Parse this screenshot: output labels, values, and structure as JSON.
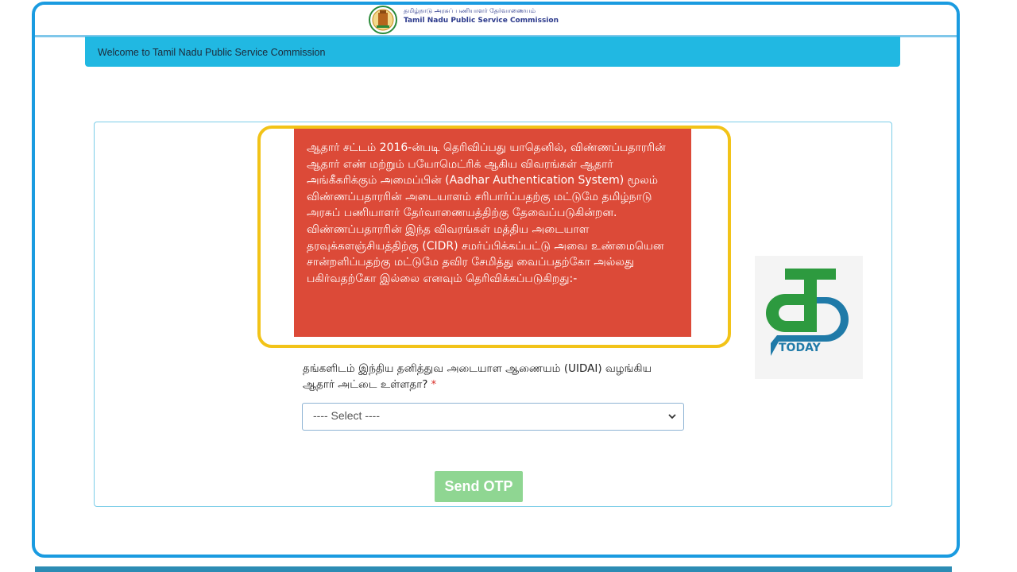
{
  "header": {
    "org_name_tamil": "தமிழ்நாடு அரசுப் பணியாளர் தேர்வாணையம்",
    "org_name_english": "Tamil Nadu Public Service Commission",
    "logo_icon": "tamil-nadu-emblem-icon"
  },
  "welcome": {
    "text": "Welcome to Tamil Nadu Public Service Commission"
  },
  "notice": {
    "text": "ஆதார் சட்டம் 2016-ன்படி தெரிவிப்பது யாதெனில், விண்ணப்பதாரரின் ஆதார் எண் மற்றும் பயோமெட்ரிக் ஆகிய விவரங்கள் ஆதார் அங்கீகரிக்கும் அமைப்பின் (Aadhar Authentication System) மூலம் விண்ணப்பதாரரின் அடையாளம் சரிபார்ப்பதற்கு மட்டுமே தமிழ்நாடு அரசுப் பணியாளர் தேர்வாணையத்திற்கு தேவைப்படுகின்றன. விண்ணப்பதாரரின் இந்த விவரங்கள் மத்திய அடையாள தரவுக்களஞ்சியத்திற்கு (CIDR) சமர்ப்பிக்கப்பட்டு அவை உண்மையென சான்றளிப்பதற்கு மட்டுமே தவிர சேமித்து வைப்பதற்கோ அல்லது பகிர்வதற்கோ இல்லை எனவும் தெரிவிக்கப்படுகிறது:-",
    "background_color": "#dc4a38",
    "outline_color": "#f2c318"
  },
  "form": {
    "question": "தங்களிடம் இந்திய தனித்துவ அடையாள ஆணையம் (UIDAI) வழங்கிய ஆதார் அட்டை உள்ளதா?",
    "required_marker": "*",
    "select_value": "---- Select ----",
    "send_otp_label": "Send OTP"
  },
  "watermark": {
    "text": "TODAY",
    "icon": "tamil-today-logo-icon"
  },
  "colors": {
    "accent": "#21b8e2",
    "frame": "#1a9be0",
    "button": "#8fd692"
  }
}
